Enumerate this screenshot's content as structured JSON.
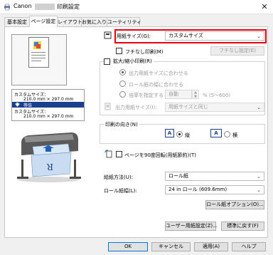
{
  "window": {
    "title_prefix": "Canon",
    "title_suffix": "印刷設定",
    "close_glyph": "✕"
  },
  "tabs": [
    {
      "label": "基本設定"
    },
    {
      "label": "ページ設定"
    },
    {
      "label": "レイアウト"
    },
    {
      "label": "お気に入り"
    },
    {
      "label": "ユーティリティ"
    }
  ],
  "left": {
    "size_title1": "カスタムサイズ：",
    "size_value1": "210.0 mm × 297.0 mm",
    "scale_label": "等倍",
    "size_title2": "カスタムサイズ：",
    "size_value2": "210.0 mm × 297.0 mm"
  },
  "page_setup": {
    "paper_size_label": "用紙サイズ(G):",
    "paper_size_value": "カスタムサイズ",
    "borderless_label": "フチなし印刷(M)",
    "borderless_settings_button": "フチなし設定(E)",
    "scaled_label": "拡大/縮小印刷(R)",
    "fit_paper_label": "出力用紙サイズに合わせる",
    "fit_roll_label": "ロール紙の幅に合わせる",
    "scale_specify_label": "倍率を指定する",
    "scale_value": "自動",
    "scale_range": "% (5～600)",
    "output_size_label": "出力用紙サイズ(I):",
    "output_size_value": "用紙サイズと同じ",
    "orientation_legend": "印刷の向き(N)",
    "portrait_label": "縦",
    "landscape_label": "横",
    "rotate_label": "ページを90度回転(用紙節約)(T)",
    "feed_label": "給紙方法(U):",
    "feed_value": "ロール紙",
    "roll_width_label": "ロール紙幅(L):",
    "roll_width_value": "24 in ロール (609.6mm)",
    "roll_options_button": "ロール紙オプション(O)...",
    "custom_paper_button": "ユーザー用紙設定(Z)...",
    "defaults_button": "標準に戻す(F)"
  },
  "footer": {
    "ok": "OK",
    "cancel": "キャンセル",
    "apply": "適用(A)",
    "help": "ヘルプ"
  },
  "colors": {
    "highlight": "#e60012",
    "size_bar": "#1a3f8c"
  }
}
